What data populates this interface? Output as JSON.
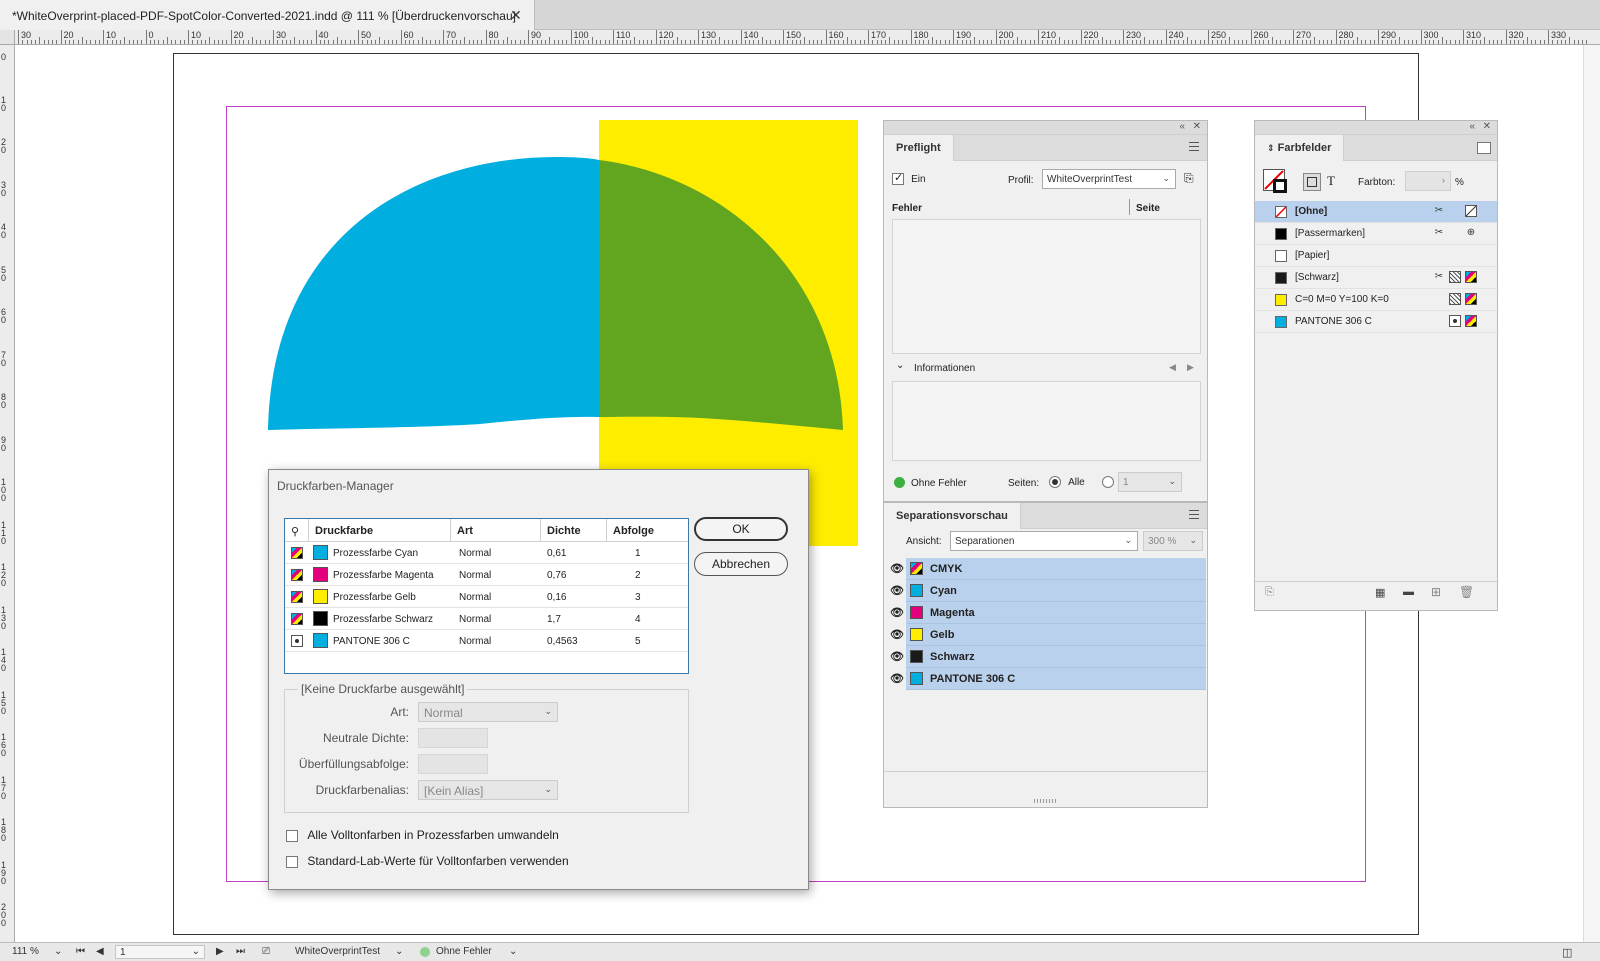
{
  "document": {
    "tab_title": "*WhiteOverprint-placed-PDF-SpotColor-Converted-2021.indd @ 111 % [Überdruckenvorschau]",
    "close_glyph": "✕"
  },
  "ruler": {
    "h_labels": [
      "30",
      "20",
      "10",
      "0",
      "10",
      "20",
      "30",
      "40",
      "50",
      "60",
      "70",
      "80",
      "90",
      "100",
      "110",
      "120",
      "130",
      "140",
      "150",
      "160",
      "170",
      "180",
      "190",
      "200",
      "210",
      "220",
      "230",
      "240",
      "250",
      "260",
      "270",
      "280",
      "290",
      "300",
      "310",
      "320",
      "330"
    ],
    "v_labels": [
      "0",
      "1 0",
      "2 0",
      "3 0",
      "4 0",
      "5 0",
      "6 0",
      "7 0",
      "8 0",
      "9 0",
      "1 0 0",
      "1 1 0",
      "1 2 0",
      "1 3 0",
      "1 4 0",
      "1 5 0",
      "1 6 0",
      "1 7 0",
      "1 8 0",
      "1 9 0",
      "2 0 0"
    ]
  },
  "artwork": {
    "cyan": "#00AEE0",
    "yellow": "#FFED00",
    "green": "#62A620"
  },
  "preflight": {
    "tab": "Preflight",
    "on_label": "Ein",
    "on_checked": true,
    "profile_label": "Profil:",
    "profile_value": "WhiteOverprintTest",
    "col_errors": "Fehler",
    "col_page": "Seite",
    "info_label": "Informationen",
    "status": "Ohne Fehler",
    "status_color": "#3CB043",
    "pages_label": "Seiten:",
    "all_label": "Alle",
    "range_value": "1"
  },
  "separations": {
    "tab": "Separationsvorschau",
    "view_label": "Ansicht:",
    "view_value": "Separationen",
    "zoom_value": "300 %",
    "rows": [
      {
        "name": "CMYK",
        "swatch": "cmyk"
      },
      {
        "name": "Cyan",
        "swatch": "#00AEE0"
      },
      {
        "name": "Magenta",
        "swatch": "#E4007C"
      },
      {
        "name": "Gelb",
        "swatch": "#FFED00"
      },
      {
        "name": "Schwarz",
        "swatch": "#1a1a1a"
      },
      {
        "name": "PANTONE 306 C",
        "swatch": "#00AEE0"
      }
    ]
  },
  "swatches": {
    "tab": "Farbfelder",
    "tint_label": "Farbton:",
    "tint_value": "",
    "percent": "%",
    "text_icon": "T",
    "rows": [
      {
        "name": "[Ohne]",
        "color": "none",
        "selected": true
      },
      {
        "name": "[Passermarken]",
        "color": "#000000",
        "selected": false
      },
      {
        "name": "[Papier]",
        "color": "#ffffff",
        "selected": false
      },
      {
        "name": "[Schwarz]",
        "color": "#1a1a1a",
        "selected": false
      },
      {
        "name": "C=0 M=0 Y=100 K=0",
        "color": "#FFED00",
        "selected": false
      },
      {
        "name": "PANTONE 306 C",
        "color": "#00AEE0",
        "selected": false
      }
    ]
  },
  "ink_manager": {
    "title": "Druckfarben-Manager",
    "col_ink": "Druckfarbe",
    "col_type": "Art",
    "col_density": "Dichte",
    "col_sequence": "Abfolge",
    "inks": [
      {
        "name": "Prozessfarbe Cyan",
        "type": "Normal",
        "density": "0,61",
        "sequence": "1",
        "color": "#00AEE0",
        "kind": "process"
      },
      {
        "name": "Prozessfarbe Magenta",
        "type": "Normal",
        "density": "0,76",
        "sequence": "2",
        "color": "#E4007C",
        "kind": "process"
      },
      {
        "name": "Prozessfarbe Gelb",
        "type": "Normal",
        "density": "0,16",
        "sequence": "3",
        "color": "#FFED00",
        "kind": "process"
      },
      {
        "name": "Prozessfarbe Schwarz",
        "type": "Normal",
        "density": "1,7",
        "sequence": "4",
        "color": "#000000",
        "kind": "process"
      },
      {
        "name": "PANTONE 306 C",
        "type": "Normal",
        "density": "0,4563",
        "sequence": "5",
        "color": "#00AEE0",
        "kind": "spot"
      }
    ],
    "ok_label": "OK",
    "cancel_label": "Abbrechen",
    "none_selected": "[Keine Druckfarbe ausgewählt]",
    "type_label": "Art:",
    "type_value": "Normal",
    "neutral_density_label": "Neutrale Dichte:",
    "trap_sequence_label": "Überfüllungsabfolge:",
    "alias_label": "Druckfarbenalias:",
    "alias_value": "[Kein Alias]",
    "convert_all_label": "Alle Volltonfarben in Prozessfarben umwandeln",
    "convert_all_checked": false,
    "lab_values_label": "Standard-Lab-Werte für Volltonfarben verwenden",
    "lab_values_checked": false
  },
  "statusbar": {
    "zoom": "111 %",
    "page": "1",
    "profile": "WhiteOverprintTest",
    "status": "Ohne Fehler"
  }
}
